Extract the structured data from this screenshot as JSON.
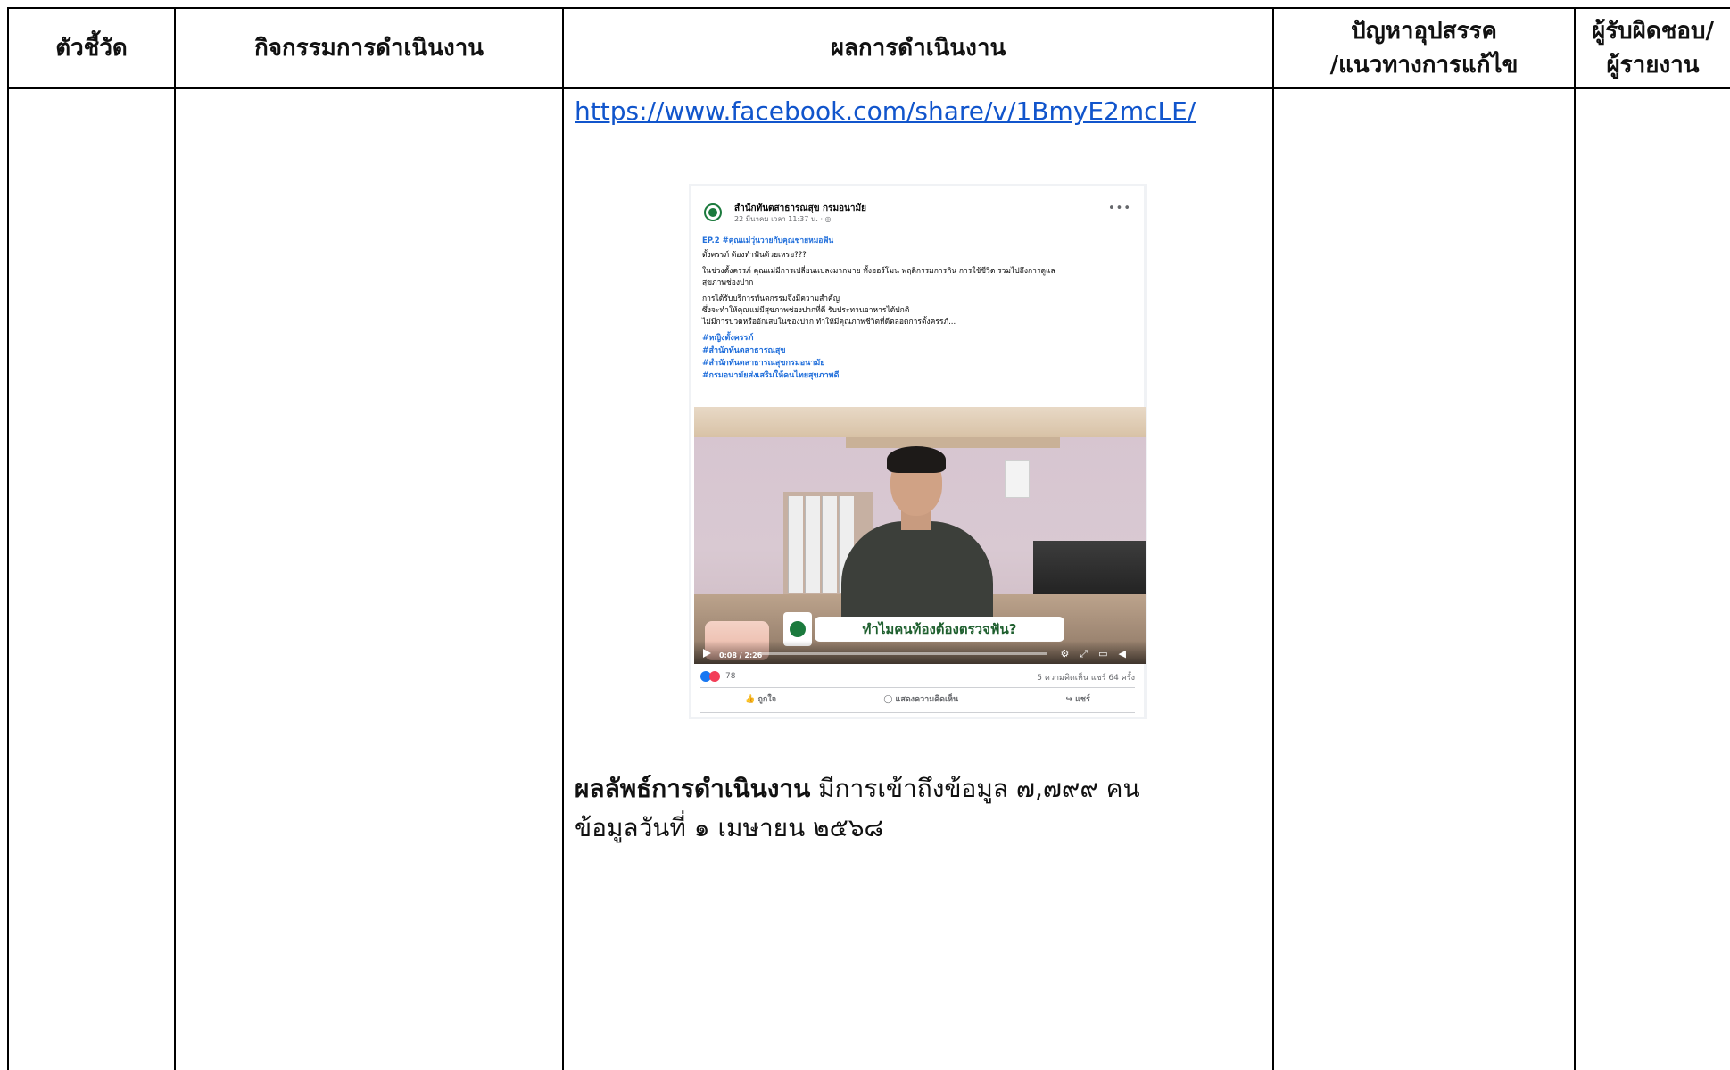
{
  "headers": {
    "indicator": "ตัวชี้วัด",
    "activities": "กิจกรรมการดำเนินงาน",
    "results": "ผลการดำเนินงาน",
    "problems_line1": "ปัญหาอุปสรรค",
    "problems_line2": "/แนวทางการแก้ไข",
    "responsible_line1": "ผู้รับผิดชอบ/",
    "responsible_line2": "ผู้รายงาน"
  },
  "content": {
    "link": "https://www.facebook.com/share/v/1BmyE2mcLE/",
    "result_label": "ผลลัพธ์การดำเนินงาน",
    "result_text": " มีการเข้าถึงข้อมูล ๗,๗๙๙ คน",
    "result_date": "ข้อมูลวันที่ ๑ เมษายน ๒๕๖๘"
  },
  "post": {
    "page_name": "สำนักทันตสาธารณสุข กรมอนามัย",
    "time": "22 มีนาคม เวลา 11:37 น. · ◎",
    "lines": [
      "EP.2 #คุณแม่วุ่นวายกับคุณชายหมอฟัน",
      "ตั้งครรภ์ ต้องทำฟันด้วยเหรอ???",
      "ในช่วงตั้งครรภ์ คุณแม่มีการเปลี่ยนแปลงมากมาย ทั้งฮอร์โมน พฤติกรรมการกิน การใช้ชีวิต รวมไปถึงการดูแล",
      "สุขภาพช่องปาก",
      "การได้รับบริการทันตกรรมจึงมีความสำคัญ",
      "ซึ่งจะทำให้คุณแม่มีสุขภาพช่องปากที่ดี รับประทานอาหารได้ปกติ",
      "ไม่มีการปวดหรืออักเสบในช่องปาก ทำให้มีคุณภาพชีวิตที่ดีตลอดการตั้งครรภ์..."
    ],
    "hashtags": [
      "#หญิงตั้งครรภ์",
      "#สำนักทันตสาธารณสุข",
      "#สำนักทันตสาธารณสุขกรมอนามัย",
      "#กรมอนามัยส่งเสริมให้คนไทยสุขภาพดี"
    ],
    "video_caption": "ทำไมคนท้องต้องตรวจฟัน?",
    "video_time": "0:08 / 2:26",
    "reactions": "78",
    "stats": "5 ความคิดเห็น   แชร์ 64 ครั้ง",
    "action_like": "👍 ถูกใจ",
    "action_comment": "◯ แสดงความคิดเห็น",
    "action_share": "↪ แชร์",
    "accent_color": "#1877f2",
    "hashtag_color": "#216fdb"
  }
}
